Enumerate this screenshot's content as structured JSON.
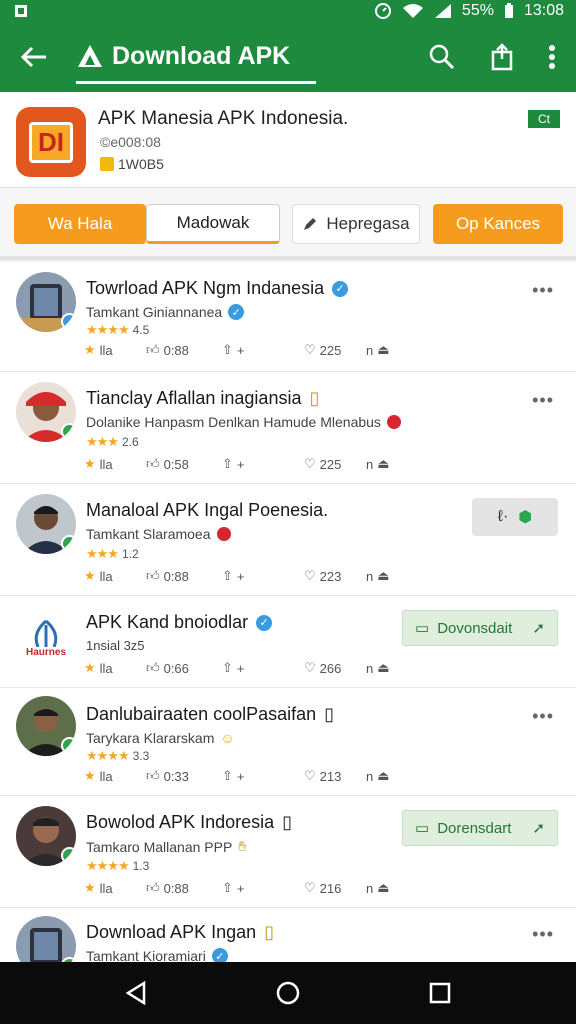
{
  "status_bar": {
    "battery": "55%",
    "time": "13:08"
  },
  "app_bar": {
    "title": "Download APK"
  },
  "app_header": {
    "name": "APK Manesia APK Indonesia.",
    "meta1": "©e008:08",
    "meta2": "1̲̲ 1​W0B5",
    "meta2_text": "1W0B5",
    "corner_tag": "Ct"
  },
  "tabs": [
    {
      "label": "Wa Hala"
    },
    {
      "label": "Madowak"
    },
    {
      "label": "Hepregasa"
    },
    {
      "label": "Op Kances"
    }
  ],
  "feed": [
    {
      "title": "Towrload APK Ngm Indanesia",
      "sub": "Tamkant Giniannanea",
      "rating": "4.5",
      "stat1": "lla",
      "stat2": "0:88",
      "stat3": "+",
      "likes": "225",
      "stat5": "n",
      "avatar_color": "#8b9cb0"
    },
    {
      "title": "Tianclay Aflallan inagiansia",
      "sub": "Dolanike Hanpasm Denlkan Hamude Mlenabus",
      "rating": "2.6",
      "stat1": "lla",
      "stat2": "0:58",
      "stat3": "+",
      "likes": "225",
      "stat5": "n",
      "avatar_color": "#c83a33"
    },
    {
      "title": "Manaloal APK Ingal Poenesia.",
      "sub": "Tamkant Slaramoea",
      "rating": "1.2",
      "stat1": "lla",
      "stat2": "0:88",
      "stat3": "+",
      "likes": "223",
      "stat5": "n",
      "avatar_color": "#4d5a6c"
    },
    {
      "title": "APK Kand bnoiodlar",
      "sub": "1nsial 3z5",
      "rating": "",
      "stat1": "lla",
      "stat2": "0:66",
      "stat3": "+",
      "likes": "266",
      "stat5": "n",
      "logo_text": "Haurnes",
      "download_label": "Dovonsdait"
    },
    {
      "title": "Danlubairaaten coolPasaifan",
      "sub": "Tarykara Klararskam",
      "rating": "3.3",
      "stat1": "lla",
      "stat2": "0:33",
      "stat3": "+",
      "likes": "213",
      "stat5": "n",
      "avatar_color": "#5c6f4a"
    },
    {
      "title": "Bowolod APK Indoresia",
      "sub": "Tamkaro Mallanan PPP",
      "rating": "1.3",
      "stat1": "lla",
      "stat2": "0:88",
      "stat3": "+",
      "likes": "216",
      "stat5": "n",
      "avatar_color": "#4a3a3a",
      "download_label": "Dorensdart"
    },
    {
      "title": "Download APK Ingan",
      "sub": "Tamkant Kioramiari",
      "rating": "",
      "avatar_color": "#8b9cb0"
    }
  ]
}
